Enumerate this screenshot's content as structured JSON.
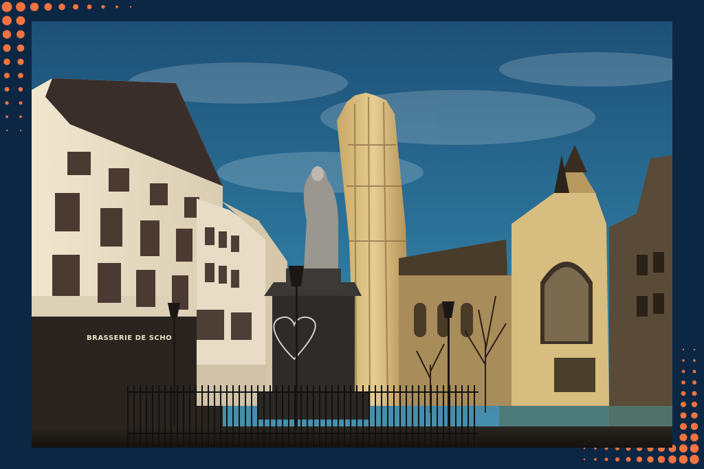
{
  "photo": {
    "alt_subject": "statue-and-cathedral-square",
    "storefront_sign": "BRASSERIE DE SCHO"
  },
  "colors": {
    "frame": "#0c2744",
    "dot_accent": "#f2733f",
    "sky_top": "#1d4f76",
    "sky_bottom": "#3a8ab0",
    "stone_lit": "#e0c486",
    "stone_shadow": "#6a5a3c"
  }
}
